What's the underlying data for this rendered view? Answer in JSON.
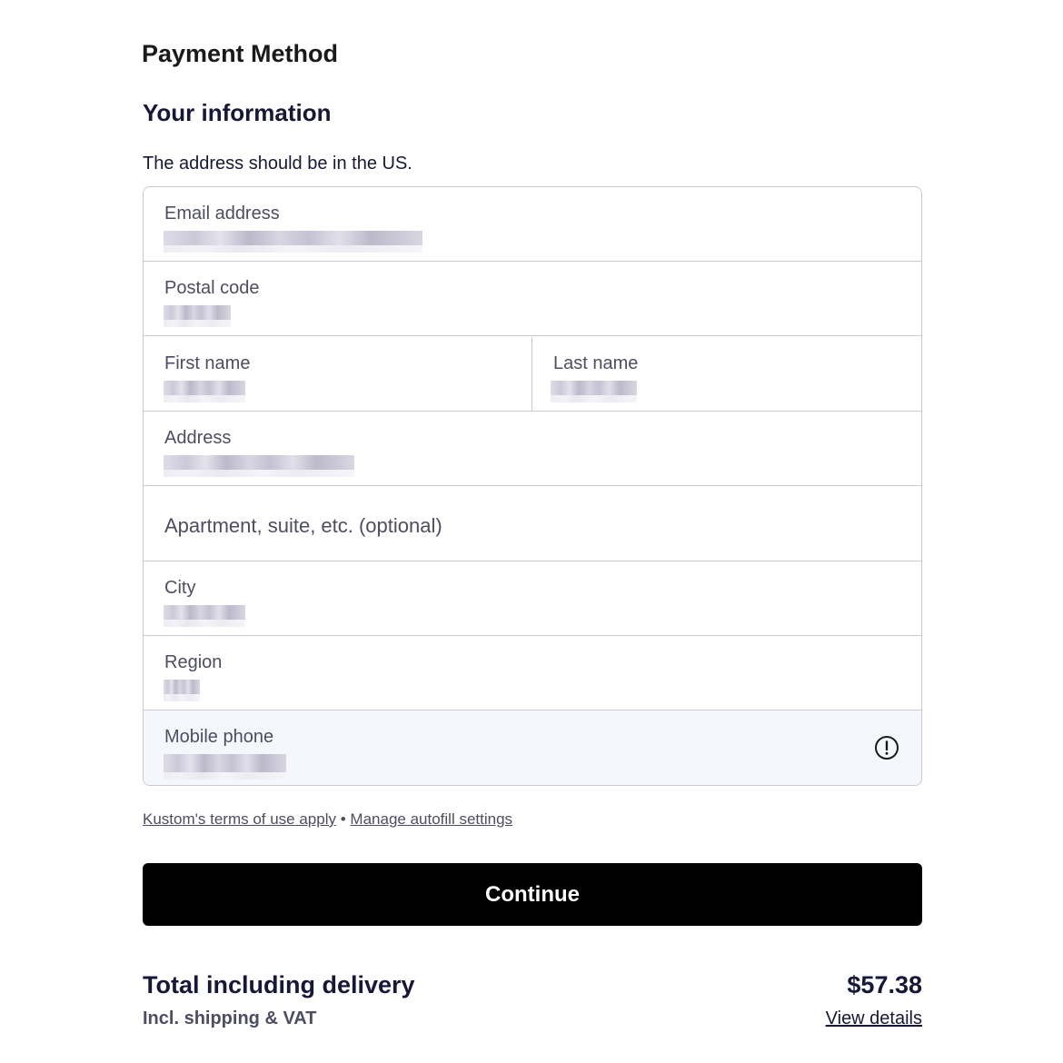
{
  "header": {
    "title": "Payment Method"
  },
  "section": {
    "title": "Your information",
    "hint": "The address should be in the US."
  },
  "form": {
    "email": {
      "label": "Email address"
    },
    "postal_code": {
      "label": "Postal code"
    },
    "first_name": {
      "label": "First name"
    },
    "last_name": {
      "label": "Last name"
    },
    "address": {
      "label": "Address"
    },
    "apartment": {
      "placeholder": "Apartment, suite, etc. (optional)"
    },
    "city": {
      "label": "City"
    },
    "region": {
      "label": "Region"
    },
    "mobile_phone": {
      "label": "Mobile phone",
      "status_icon": "alert-circle-icon"
    }
  },
  "links": {
    "terms": "Kustom's terms of use apply",
    "separator": "•",
    "autofill": "Manage autofill settings"
  },
  "actions": {
    "continue_label": "Continue"
  },
  "summary": {
    "total_label": "Total including delivery",
    "total_sub": "Incl. shipping & VAT",
    "total_amount": "$57.38",
    "view_details": "View details"
  },
  "colors": {
    "button_bg": "#000000",
    "text_dark": "#17173a",
    "text_muted": "#4d4d63",
    "border": "#c9c9d0",
    "phone_field_bg": "#f4f7fb"
  }
}
